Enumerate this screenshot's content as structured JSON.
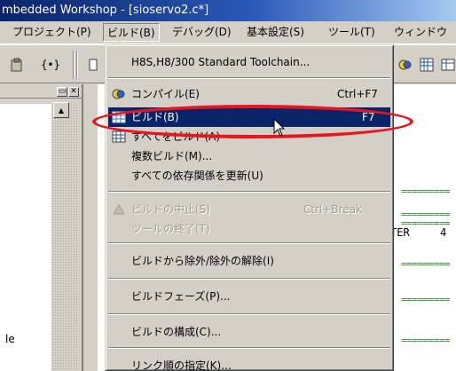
{
  "window": {
    "title": "mbedded Workshop - [sioservo2.c*]"
  },
  "menubar": {
    "items": [
      {
        "label": "プロジェクト(P)"
      },
      {
        "label": "ビルド(B)"
      },
      {
        "label": "デバッグ(D)"
      },
      {
        "label": "基本設定(S)"
      },
      {
        "label": "ツール(T)"
      },
      {
        "label": "ウィンドウ"
      }
    ]
  },
  "build_menu": {
    "toolchain": "H8S,H8/300 Standard Toolchain...",
    "compile": {
      "label": "コンパイル(E)",
      "shortcut": "Ctrl+F7"
    },
    "build": {
      "label": "ビルド(B)",
      "shortcut": "F7"
    },
    "build_all": {
      "label": "すべてをビルド(A)"
    },
    "multi_build": {
      "label": "複数ビルド(M)..."
    },
    "update_deps": {
      "label": "すべての依存関係を更新(U)"
    },
    "stop_build": {
      "label": "ビルドの中止(S)",
      "shortcut": "Ctrl+Break"
    },
    "stop_tool": {
      "label": "ツールの終了(T)"
    },
    "exclude": {
      "label": "ビルドから除外/除外の解除(I)"
    },
    "phases": {
      "label": "ビルドフェーズ(P)..."
    },
    "config": {
      "label": "ビルドの構成(C)..."
    },
    "link_order": {
      "label": "リンク順の指定(K)..."
    }
  },
  "editor": {
    "eq_lines": [
      "=========",
      "=========",
      "=========",
      "=========",
      "=========",
      "========="
    ],
    "ter_text": "TER",
    "num_text": "4"
  },
  "workspace": {
    "label": "le"
  },
  "highlight_color": "#e8151b",
  "selection_color": "#0a246a"
}
